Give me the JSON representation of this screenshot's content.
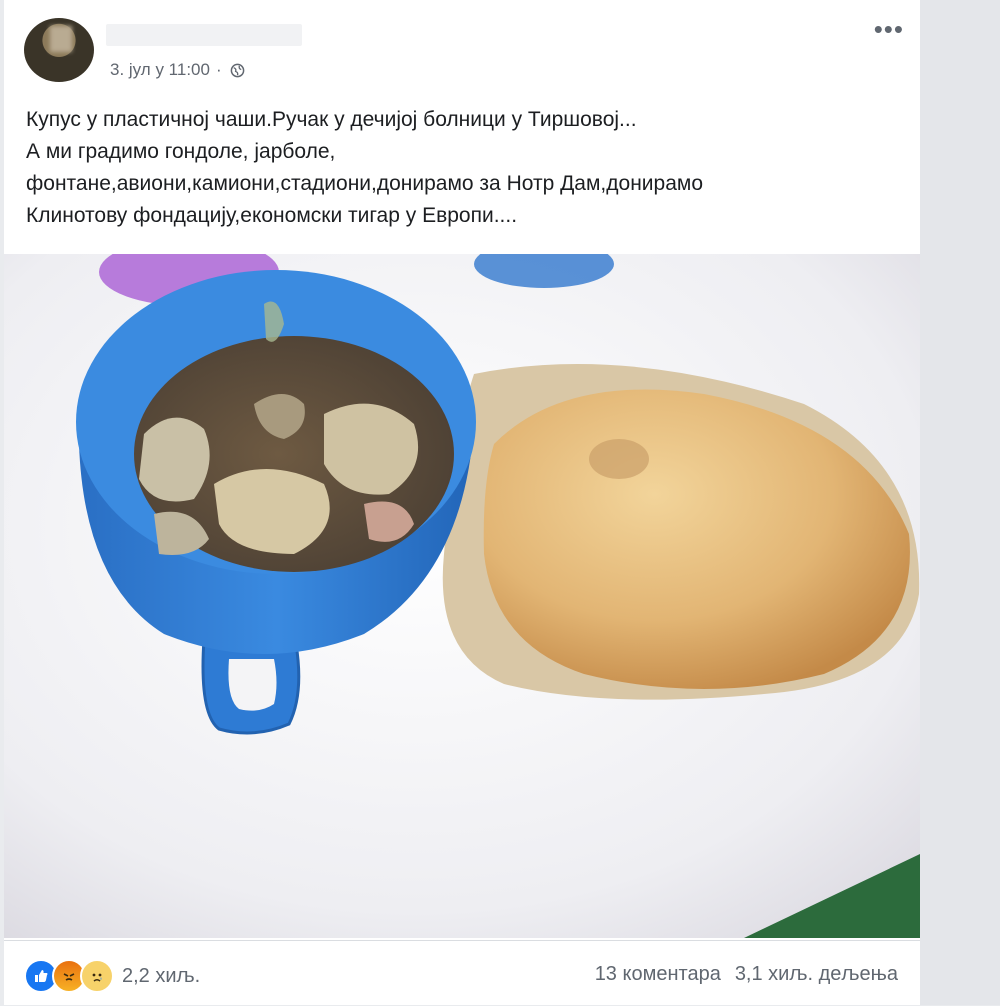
{
  "post": {
    "timestamp": "3. јул у 11:00",
    "privacy_separator": "·",
    "privacy_icon": "globe-icon",
    "more_icon": "more-options-icon",
    "more_label": "•••",
    "text_lines": [
      "Купус у пластичној чаши.Ручак у дечијој болници у Тиршовој...",
      "А ми градимо гондоле, јарболе,",
      "фонтане,авиони,камиони,стадиони,донирамо за Нотр Дам,донирамо",
      "Клинотову фондацију,економски тигар у Европи...."
    ],
    "photo": {
      "description_icon": "food-photo",
      "colors": {
        "cup": "#2f7fd6",
        "table": "#f2f2f4",
        "bread": "#e2b574"
      }
    }
  },
  "footer": {
    "reactions": [
      "like-icon",
      "angry-icon",
      "sad-icon"
    ],
    "reaction_count": "2,2 хиљ.",
    "comments": "13 коментара",
    "shares": "3,1 хиљ. дељења"
  }
}
